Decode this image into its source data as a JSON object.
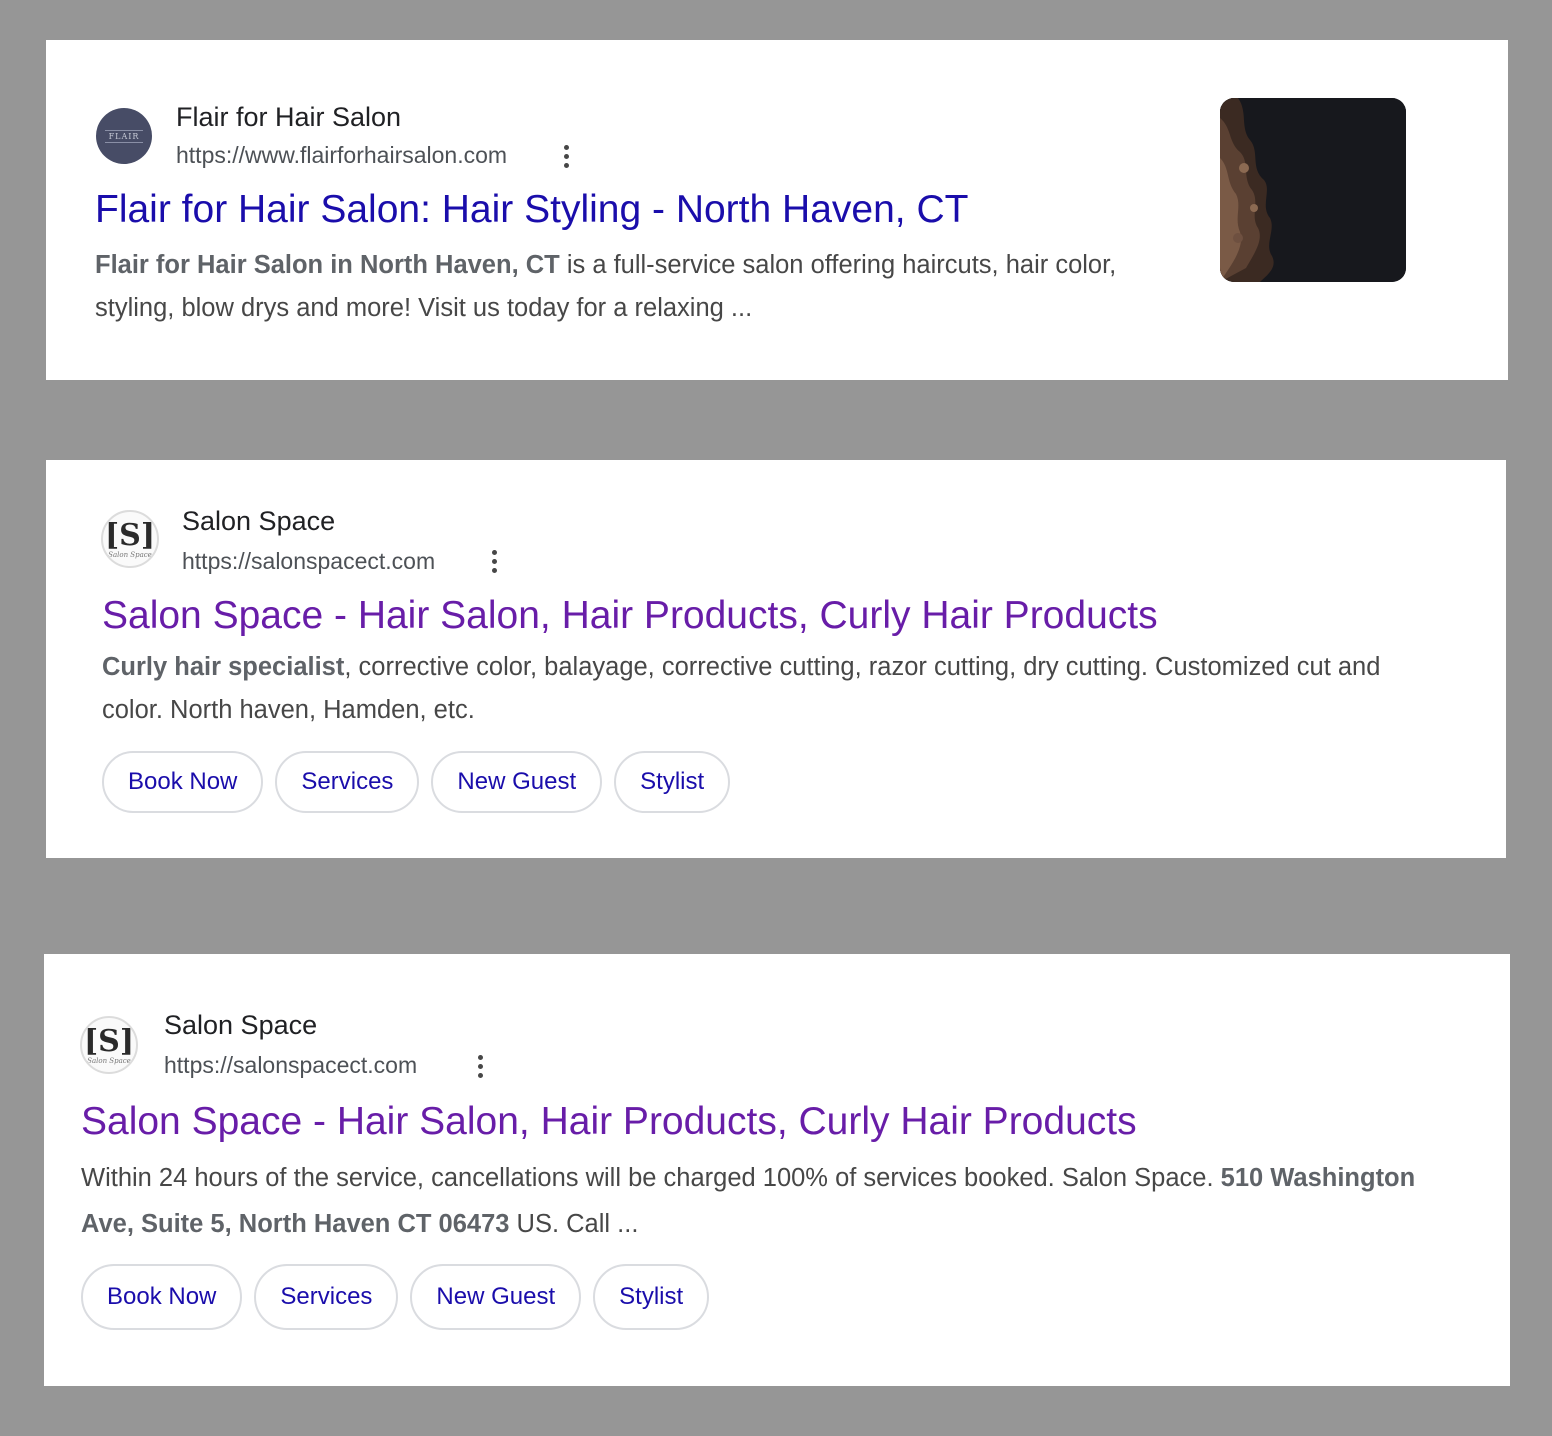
{
  "results": [
    {
      "site_name": "Flair for Hair Salon",
      "url": "https://www.flairforhairsalon.com",
      "favicon_text": "FLAIR",
      "title": "Flair for Hair Salon: Hair Styling - North Haven, CT",
      "snippet_bold": "Flair for Hair Salon in North Haven, CT",
      "snippet_rest": " is a full-service salon offering haircuts, hair color, styling, blow drys and more! Visit us today for a relaxing ...",
      "thumbnail": "woman-curly-hair-photo"
    },
    {
      "site_name": "Salon Space",
      "url": "https://salonspacect.com",
      "favicon_letter": "[S]",
      "favicon_sub": "Salon Space",
      "title": "Salon Space - Hair Salon, Hair Products, Curly Hair Products",
      "snippet_bold": "Curly hair specialist",
      "snippet_rest": ", corrective color, balayage, corrective cutting, razor cutting, dry cutting. Customized cut and color. North haven, Hamden, etc.",
      "sitelinks": [
        "Book Now",
        "Services",
        "New Guest",
        "Stylist"
      ]
    },
    {
      "site_name": "Salon Space",
      "url": "https://salonspacect.com",
      "favicon_letter": "[S]",
      "favicon_sub": "Salon Space",
      "title": "Salon Space - Hair Salon, Hair Products, Curly Hair Products",
      "snippet_start": "Within 24 hours of the service, cancellations will be charged 100% of services booked. Salon Space. ",
      "snippet_bold": "510 Washington Ave, Suite 5, North Haven CT 06473",
      "snippet_end": " US. Call ...",
      "sitelinks": [
        "Book Now",
        "Services",
        "New Guest",
        "Stylist"
      ]
    }
  ],
  "colors": {
    "background": "#969696",
    "title_visited": "#681da8",
    "title_link": "#1a0dab",
    "chip_text": "#1a0dab"
  }
}
